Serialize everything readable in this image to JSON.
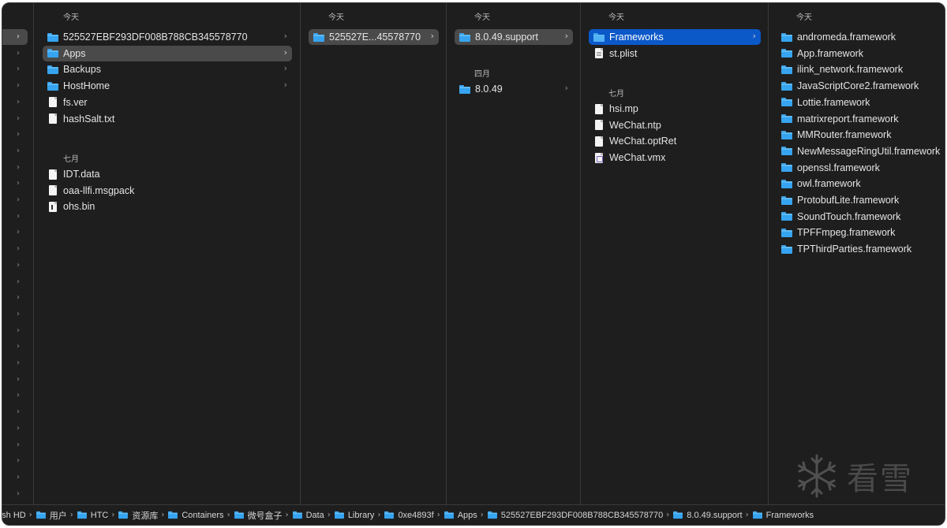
{
  "columns": {
    "sidebar_chevron": "›",
    "col1": {
      "section_today": "今天",
      "items_today": [
        {
          "label": "525527EBF293DF008B788CB345578770",
          "type": "folder",
          "has_chevron": true
        },
        {
          "label": "Apps",
          "type": "folder",
          "has_chevron": true,
          "selected": "grey"
        },
        {
          "label": "Backups",
          "type": "folder",
          "has_chevron": true
        },
        {
          "label": "HostHome",
          "type": "folder",
          "has_chevron": true
        },
        {
          "label": "fs.ver",
          "type": "doc"
        },
        {
          "label": "hashSalt.txt",
          "type": "doc"
        }
      ],
      "section_july": "七月",
      "items_july": [
        {
          "label": "IDT.data",
          "type": "doc"
        },
        {
          "label": "oaa-llfi.msgpack",
          "type": "doc"
        },
        {
          "label": "ohs.bin",
          "type": "doc-bin"
        }
      ]
    },
    "col2": {
      "section_today": "今天",
      "items_today": [
        {
          "label": "525527E...45578770",
          "type": "folder",
          "has_chevron": true,
          "selected": "grey"
        }
      ]
    },
    "col3": {
      "section_today": "今天",
      "items_today": [
        {
          "label": "8.0.49.support",
          "type": "folder",
          "has_chevron": true,
          "selected": "grey"
        }
      ],
      "section_april": "四月",
      "items_april": [
        {
          "label": "8.0.49",
          "type": "folder",
          "has_chevron": true
        }
      ]
    },
    "col4": {
      "section_today": "今天",
      "items_today": [
        {
          "label": "Frameworks",
          "type": "folder",
          "has_chevron": true,
          "selected": "blue"
        },
        {
          "label": "st.plist",
          "type": "doc-plist"
        }
      ],
      "section_july": "七月",
      "items_july": [
        {
          "label": "hsi.mp",
          "type": "doc"
        },
        {
          "label": "WeChat.ntp",
          "type": "doc"
        },
        {
          "label": "WeChat.optRet",
          "type": "doc"
        },
        {
          "label": "WeChat.vmx",
          "type": "doc-vmx"
        }
      ]
    },
    "col5": {
      "section_today": "今天",
      "items_today": [
        {
          "label": "andromeda.framework",
          "type": "folder"
        },
        {
          "label": "App.framework",
          "type": "folder"
        },
        {
          "label": "ilink_network.framework",
          "type": "folder"
        },
        {
          "label": "JavaScriptCore2.framework",
          "type": "folder"
        },
        {
          "label": "Lottie.framework",
          "type": "folder"
        },
        {
          "label": "matrixreport.framework",
          "type": "folder"
        },
        {
          "label": "MMRouter.framework",
          "type": "folder"
        },
        {
          "label": "NewMessageRingUtil.framework",
          "type": "folder"
        },
        {
          "label": "openssl.framework",
          "type": "folder"
        },
        {
          "label": "owl.framework",
          "type": "folder"
        },
        {
          "label": "ProtobufLite.framework",
          "type": "folder"
        },
        {
          "label": "SoundTouch.framework",
          "type": "folder"
        },
        {
          "label": "TPFFmpeg.framework",
          "type": "folder"
        },
        {
          "label": "TPThirdParties.framework",
          "type": "folder"
        }
      ]
    }
  },
  "path_bar": {
    "separator": "›",
    "crumbs": [
      {
        "label": "tosh HD",
        "icon": "none"
      },
      {
        "label": "用户",
        "icon": "folder"
      },
      {
        "label": "HTC",
        "icon": "folder"
      },
      {
        "label": "资源库",
        "icon": "folder"
      },
      {
        "label": "Containers",
        "icon": "folder"
      },
      {
        "label": "微号盒子",
        "icon": "folder"
      },
      {
        "label": "Data",
        "icon": "folder"
      },
      {
        "label": "Library",
        "icon": "folder"
      },
      {
        "label": "0xe4893f",
        "icon": "folder"
      },
      {
        "label": "Apps",
        "icon": "folder"
      },
      {
        "label": "525527EBF293DF008B788CB345578770",
        "icon": "folder"
      },
      {
        "label": "8.0.49.support",
        "icon": "folder"
      },
      {
        "label": "Frameworks",
        "icon": "folder"
      }
    ]
  },
  "watermark": {
    "text": "看雪",
    "icon": "snowflake-icon"
  },
  "colors": {
    "selection_blue": "#0b58c9",
    "selection_grey": "#4a4a4a",
    "folder_blue": "#36a4f0",
    "background": "#1e1e1e"
  }
}
